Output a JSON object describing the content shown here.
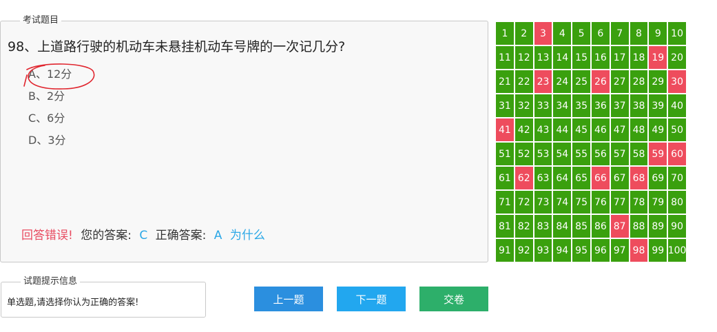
{
  "question_panel": {
    "legend": "考试题目",
    "question": "98、上道路行驶的机动车未悬挂机动车号牌的一次记几分?",
    "options": [
      "A、12分",
      "B、2分",
      "C、6分",
      "D、3分"
    ],
    "result": {
      "status": "回答错误!",
      "your_label": "您的答案:",
      "your_answer": "C",
      "correct_label": "正确答案:",
      "correct_answer": "A",
      "why_link": "为什么"
    }
  },
  "grid": {
    "numbers": [
      "1",
      "2",
      "3",
      "4",
      "5",
      "6",
      "7",
      "8",
      "9",
      "10",
      "11",
      "12",
      "13",
      "14",
      "15",
      "16",
      "17",
      "18",
      "19",
      "20",
      "21",
      "22",
      "23",
      "24",
      "25",
      "26",
      "27",
      "28",
      "29",
      "30",
      "31",
      "32",
      "33",
      "34",
      "35",
      "36",
      "37",
      "38",
      "39",
      "40",
      "41",
      "42",
      "43",
      "44",
      "45",
      "46",
      "47",
      "48",
      "49",
      "50",
      "51",
      "52",
      "53",
      "54",
      "55",
      "56",
      "57",
      "58",
      "59",
      "60",
      "61",
      "62",
      "63",
      "64",
      "65",
      "66",
      "67",
      "68",
      "69",
      "70",
      "71",
      "72",
      "73",
      "74",
      "75",
      "76",
      "77",
      "78",
      "79",
      "80",
      "81",
      "82",
      "83",
      "84",
      "85",
      "86",
      "87",
      "88",
      "89",
      "90",
      "91",
      "92",
      "93",
      "94",
      "95",
      "96",
      "97",
      "98",
      "99",
      "100"
    ],
    "wrong": [
      3,
      19,
      23,
      26,
      30,
      41,
      59,
      60,
      62,
      66,
      68,
      87,
      98
    ],
    "colors": {
      "correct": "#3aa00e",
      "wrong": "#ee4c5d"
    }
  },
  "hint_panel": {
    "legend": "试题提示信息",
    "text": "单选题,请选择你认为正确的答案!"
  },
  "buttons": {
    "prev": "上一题",
    "next": "下一题",
    "submit": "交卷"
  }
}
